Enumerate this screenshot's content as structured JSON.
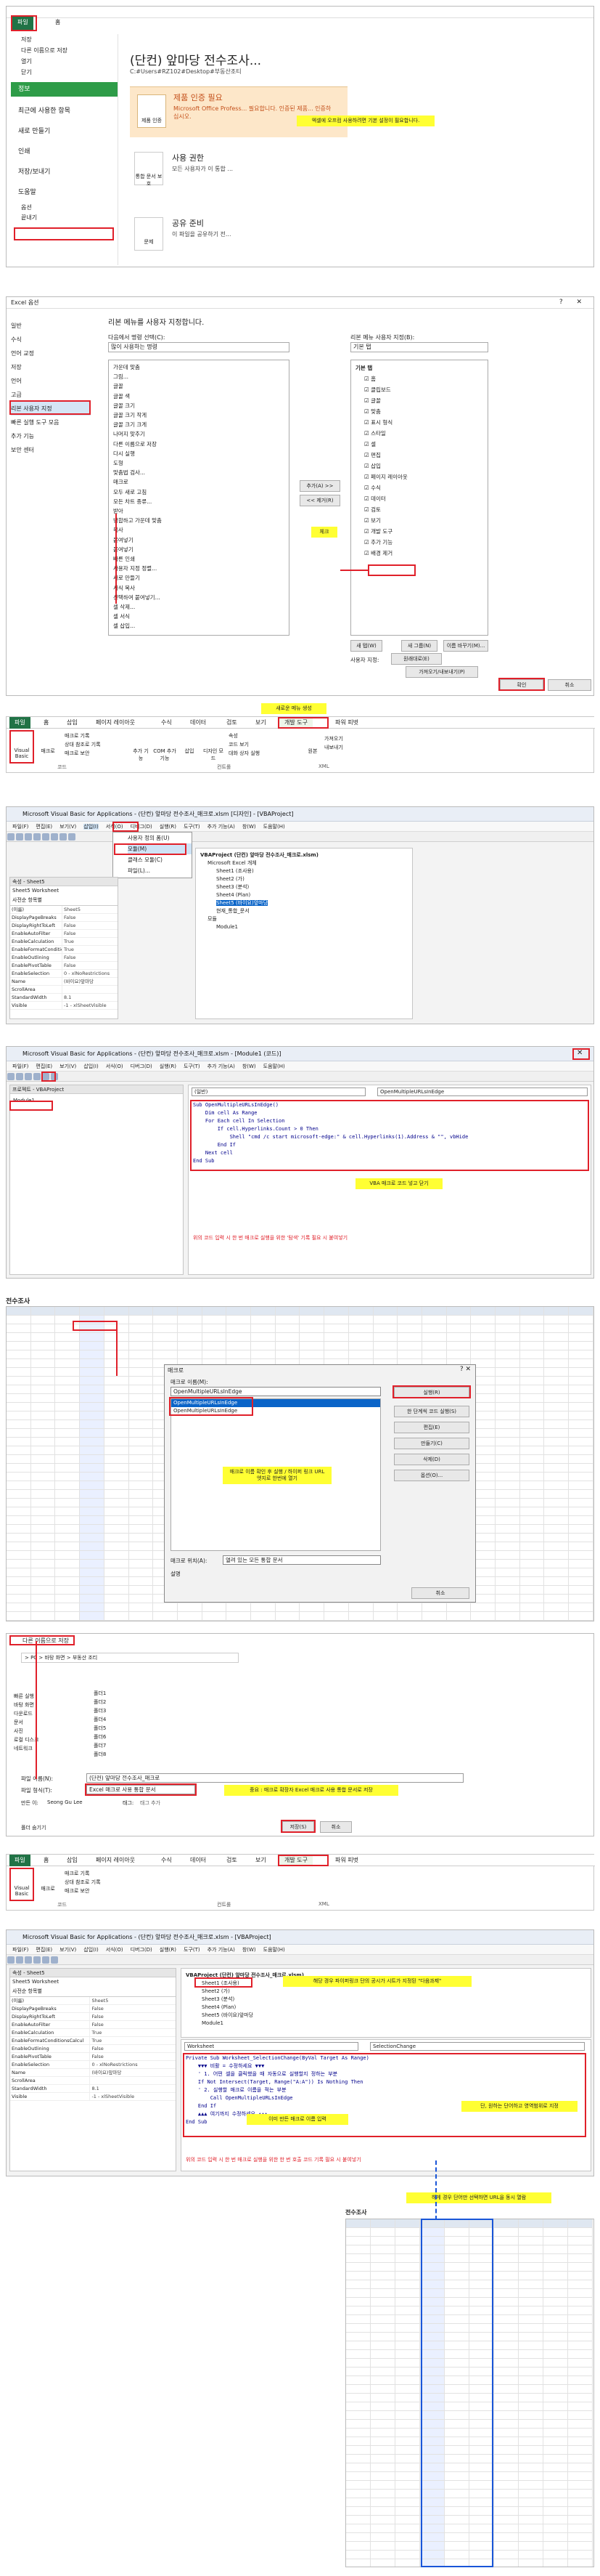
{
  "backstage": {
    "file_tab": "파일",
    "home_tab": "홈",
    "title": "(단컨) 앞마당 전수조사...",
    "path": "C:#Users#RZ102#Desktop#부동산조티",
    "menu": [
      "저장",
      "다른 이름으로 저장",
      "열기",
      "닫기",
      "정보",
      "최근에 사용한 항목",
      "새로 만들기",
      "인쇄",
      "저장/보내기",
      "도움말",
      "옵션",
      "끝내기"
    ],
    "compat_title": "제품 인증 필요",
    "compat_body": "Microsoft Office Profess... 필요합니다. 인증된 제품... 인증하십시오.",
    "compat_button": "제품 인증",
    "perm_title": "사용 권한",
    "perm_body": "모든 사용자가 이 통합 ...",
    "perm_button": "통합 문서 보호",
    "prepare_title": "공유 준비",
    "prepare_body": "이 파일을 공유하기 전...",
    "prepare_button": "문제",
    "note": "엑셀에 오프컴 사용하려면 기본 설정이 필요합니다."
  },
  "options": {
    "title": "Excel 옵션",
    "left_menu": [
      "일반",
      "수식",
      "언어 교정",
      "저장",
      "언어",
      "고급",
      "리본 사용자 지정",
      "빠른 실행 도구 모음",
      "추가 기능",
      "보안 센터"
    ],
    "header": "리본 메뉴를 사용자 지정합니다.",
    "choose_label": "다음에서 명령 선택(C):",
    "choose_value": "많이 사용하는 명령",
    "customize_label": "리본 메뉴 사용자 지정(B):",
    "customize_value": "기본 탭",
    "commands": [
      "가운데 맞춤",
      "그림...",
      "글꼴",
      "글꼴 색",
      "글꼴 크기",
      "글꼴 크기 작게",
      "글꼴 크기 크게",
      "나머지 맞추기",
      "다른 이름으로 저장",
      "다시 실행",
      "도형",
      "맞춤법 검사...",
      "매크로",
      "모두 새로 고침",
      "모든 차트 종류...",
      "받아",
      "병합하고 가운데 맞춤",
      "복사",
      "붙여넣기",
      "붙여넣기",
      "빠른 인쇄",
      "사용자 지정 정렬...",
      "새로 만들기",
      "서식 복사",
      "선택하여 붙여넣기...",
      "셀 삭제...",
      "셀 서식",
      "셀 삽입..."
    ],
    "tabs_header": "기본 탭",
    "tabs": [
      "홈",
      "클립보드",
      "글꼴",
      "맞춤",
      "표시 형식",
      "스타일",
      "셀",
      "편집",
      "삽입",
      "페이지 레이아웃",
      "수식",
      "데이터",
      "검토",
      "보기",
      "개발 도구",
      "추가 기능",
      "배경 제거"
    ],
    "add_button": "추가(A) >>",
    "remove_button": "<< 제거(R)",
    "new_tab_button": "새 탭(W)",
    "new_group_button": "새 그룹(N)",
    "rename_button": "이름 바꾸기(M)...",
    "custom_label": "사용자 지정:",
    "reset_button": "원래대로(E)",
    "import_button": "가져오기/내보내기(P)",
    "ok_button": "확인",
    "cancel_button": "취소",
    "check_note": "체크"
  },
  "dev_ribbon": {
    "tabs": [
      "파일",
      "홈",
      "삽입",
      "페이지 레이아웃",
      "수식",
      "데이터",
      "검토",
      "보기",
      "개발 도구",
      "파워 피벗"
    ],
    "vb_button": "Visual Basic",
    "macro_button": "매크로",
    "record_macro": "매크로 기록",
    "relative_ref": "상대 참조로 기록",
    "macro_security": "매크로 보안",
    "group_code": "코드",
    "addins": "추가 기능",
    "com_addins": "COM 추가 기능",
    "insert": "삽입",
    "design_mode": "디자인 모드",
    "properties": "속성",
    "view_code": "코드 보기",
    "run_dialog": "대화 상자 실행",
    "source": "원본",
    "import": "가져오기",
    "export": "내보내기",
    "group_controls": "컨트롤",
    "group_xml": "XML",
    "new_menu_note": "새로운 메뉴 생성"
  },
  "vba1": {
    "title": "Microsoft Visual Basic for Applications - (단컨) 앞마당 전수조사_매크로.xlsm [디자인] - [VBAProject]",
    "menus": [
      "파일(F)",
      "편집(E)",
      "보기(V)",
      "삽입(I)",
      "서식(O)",
      "디버그(D)",
      "실행(R)",
      "도구(T)",
      "추가 기능(A)",
      "창(W)",
      "도움말(H)"
    ],
    "insert_menu": [
      "사용자 정의 폼(U)",
      "모듈(M)",
      "클래스 모듈(C)",
      "파일(L)..."
    ],
    "props_title": "속성 - Sheet5",
    "props_object": "Sheet5 Worksheet",
    "props_tabs": "사전순  항목별",
    "props": [
      [
        "(이름)",
        "Sheet5"
      ],
      [
        "DisplayPageBreaks",
        "False"
      ],
      [
        "DisplayRightToLeft",
        "False"
      ],
      [
        "EnableAutoFilter",
        "False"
      ],
      [
        "EnableCalculation",
        "True"
      ],
      [
        "EnableFormatConditionsCalcul",
        "True"
      ],
      [
        "EnableOutlining",
        "False"
      ],
      [
        "EnablePivotTable",
        "False"
      ],
      [
        "EnableSelection",
        "0 - xlNoRestrictions"
      ],
      [
        "Name",
        "(바이요)앞마당"
      ],
      [
        "ScrollArea",
        ""
      ],
      [
        "StandardWidth",
        "8.1"
      ],
      [
        "Visible",
        "-1 - xlSheetVisible"
      ]
    ],
    "project_title": "VBAProject (단컨) 앞마당 전수조사_매크로.xlsm)",
    "tree": [
      "Microsoft Excel 개체",
      "Sheet1 (조사용)",
      "Sheet2 (가)",
      "Sheet3 (분석)",
      "Sheet4 (Plan)",
      "Sheet5 (바이요)앞마당",
      "현재_통합_문서",
      "모듈",
      "Module1"
    ]
  },
  "vba2": {
    "title": "Microsoft Visual Basic for Applications - (단컨) 앞마당 전수조사_매크로.xlsm - [Module1 (코드)]",
    "project_label": "프로젝트 - VBAProject",
    "module_label": "Module1",
    "combo_left": "(일반)",
    "combo_right": "OpenMultipleURLsInEdge",
    "code": [
      "Sub OpenMultipleURLsInEdge()",
      "    Dim cell As Range",
      "    For Each cell In Selection",
      "        If cell.Hyperlinks.Count > 0 Then",
      "            Shell \"cmd /c start microsoft-edge:\" & cell.Hyperlinks(1).Address & \"\", vbHide",
      "        End If",
      "    Next cell",
      "End Sub"
    ],
    "code_note": "VBA 매크로 코드 넣고 닫기",
    "help_note": "위의 코드 입력 시 한 번 매크로 실행을 위한 '탐색' 기록 필요 시 붙여넣기"
  },
  "macro": {
    "sheet_title": "전수조사",
    "dialog_title": "매크로",
    "name_label": "매크로 이름(M):",
    "name_value": "OpenMultipleURLsInEdge",
    "list": [
      "OpenMultipleURLsInEdge",
      "OpenMultipleURLsInEdge"
    ],
    "run_button": "실행(R)",
    "step_button": "한 단계씩 코드 실행(S)",
    "edit_button": "편집(E)",
    "create_button": "만들기(C)",
    "delete_button": "삭제(D)",
    "options_button": "옵션(O)...",
    "location_label": "매크로 위치(A):",
    "location_value": "열려 있는 모든 통합 문서",
    "desc_label": "설명",
    "cancel_button": "취소",
    "note": "매크로 이름 확인 후 실행 / 하이퍼 링크 URL 엣지로 한번에 열기"
  },
  "saveas": {
    "title": "다른 이름으로 저장",
    "path": "> PC > 바탕 화면 > 부동산 조티",
    "folders": [
      "폴더1",
      "폴더2",
      "폴더3",
      "폴더4",
      "폴더5",
      "폴더6",
      "폴더7",
      "폴더8"
    ],
    "sidebar": [
      "빠른 실행",
      "바탕 화면",
      "다운로드",
      "문서",
      "사진",
      "로컬 디스크",
      "네트워크"
    ],
    "filename_label": "파일 이름(N):",
    "filename_value": "(단컨) 앞마당 전수조사_매크로",
    "type_label": "파일 형식(T):",
    "type_value": "Excel 매크로 사용 통합 문서",
    "author_label": "만든 이:",
    "author_value": "Seong Gu Lee",
    "tags_label": "태그:",
    "tags_value": "태그 추가",
    "save_button": "저장(S)",
    "cancel_button": "취소",
    "hide_folders": "폴더 숨기기",
    "note": "중요 : 매크로 확장자 Excel 매크로 사용 통합 문서로 저장"
  },
  "vba3": {
    "title": "Microsoft Visual Basic for Applications - (단컨) 앞마당 전수조사_매크로.xlsm - [VBAProject]",
    "sheet_note": "해당 경우 파이퍼링크 단의 공시가 시트가 지정된 \"다음과제\"",
    "combo_left": "Worksheet",
    "combo_right": "SelectionChange",
    "code": [
      "Private Sub Worksheet_SelectionChange(ByVal Target As Range)",
      "    ▼▼▼ 비활 = 수정하세요 ▼▼▼",
      "    ' 1. 어떤 셀을 클릭했을 때 자동으로 실행할지 정하는 부분",
      "    If Not Intersect(Target, Range(\"A:A\")) Is Nothing Then",
      "    ' 2. 실행할 매크로 이름을 적는 부분",
      "        Call OpenMultipleURLsInEdge",
      "    End If",
      "    ▲▲▲ 여기까지 수정하세요 ▲▲▲",
      "",
      "End Sub"
    ],
    "macro_note": "이미 만든 매크로 이름 입력",
    "range_note": "단, 원하는 단어하고 영역범위로 지정",
    "help_note": "위의 코드 입력 시 한 번 매크로 실행을 위한 한 번 호출 코드 기록 필요 시 붙여넣기"
  },
  "final": {
    "note": "하게 경우 단어만 선택하면 URL을 동시 열람",
    "sheet_title": "전수조사"
  }
}
